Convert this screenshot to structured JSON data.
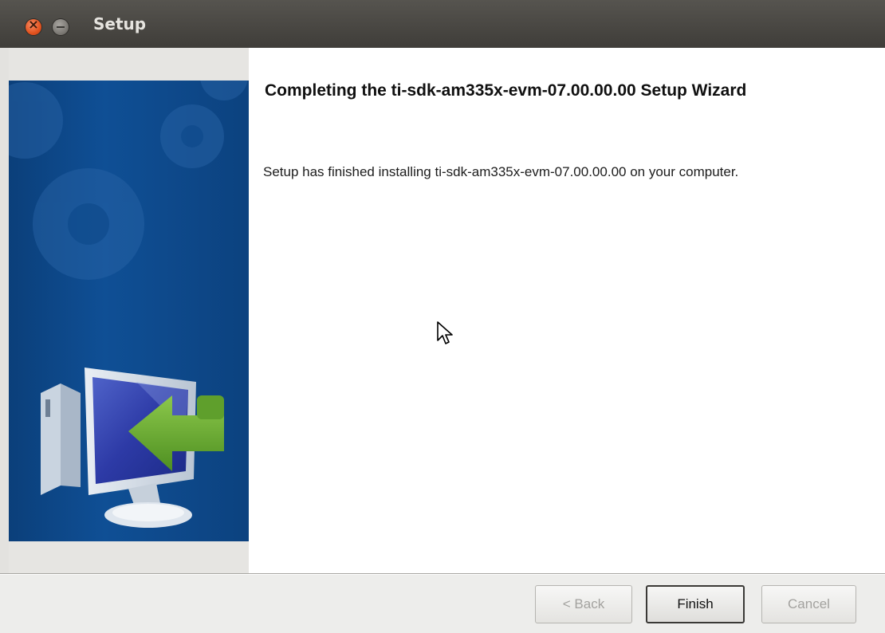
{
  "window": {
    "title": "Setup"
  },
  "wizard": {
    "heading": "Completing the ti-sdk-am335x-evm-07.00.00.00 Setup Wizard",
    "message": "Setup has finished installing ti-sdk-am335x-evm-07.00.00.00 on your computer."
  },
  "buttons": {
    "back_label": "< Back",
    "finish_label": "Finish",
    "cancel_label": "Cancel"
  },
  "icons": {
    "close": "close-icon",
    "minimize": "minimize-icon",
    "banner": "computer-install-icon",
    "cursor": "mouse-pointer-icon"
  },
  "colors": {
    "banner_blue": "#0f4f95",
    "arrow_green": "#6aad2f",
    "close_orange": "#e2531f"
  }
}
